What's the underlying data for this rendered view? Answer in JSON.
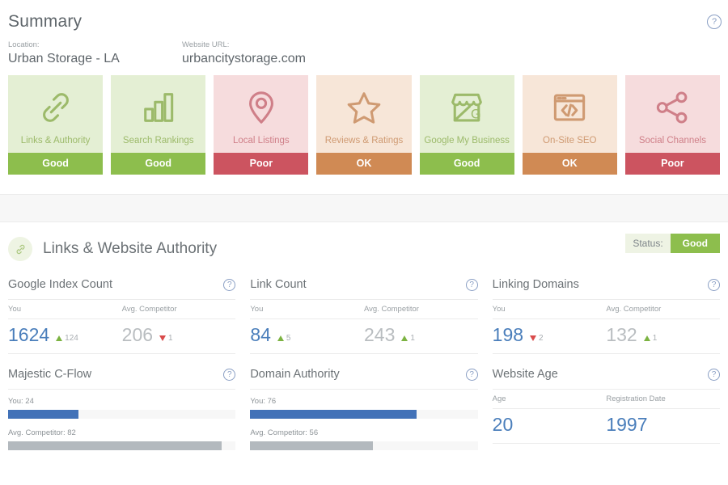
{
  "header": {
    "title": "Summary",
    "help_icon": "question-mark-icon",
    "location_label": "Location:",
    "location_value": "Urban Storage - LA",
    "url_label": "Website URL:",
    "url_value": "urbancitystorage.com"
  },
  "cards": [
    {
      "label": "Links & Authority",
      "status": "Good",
      "tone": "good",
      "icon": "chain-link-icon"
    },
    {
      "label": "Search Rankings",
      "status": "Good",
      "tone": "good",
      "icon": "bar-chart-icon"
    },
    {
      "label": "Local Listings",
      "status": "Poor",
      "tone": "poor",
      "icon": "map-pin-icon"
    },
    {
      "label": "Reviews & Ratings",
      "status": "OK",
      "tone": "ok",
      "icon": "star-icon"
    },
    {
      "label": "Google My Business",
      "status": "Good",
      "tone": "good",
      "icon": "storefront-icon"
    },
    {
      "label": "On-Site SEO",
      "status": "OK",
      "tone": "ok",
      "icon": "code-window-icon"
    },
    {
      "label": "Social Channels",
      "status": "Poor",
      "tone": "poor",
      "icon": "share-nodes-icon"
    }
  ],
  "section": {
    "icon": "chain-link-icon",
    "title": "Links & Website Authority",
    "status_label": "Status:",
    "status_value": "Good"
  },
  "metrics": {
    "google_index_count": {
      "title": "Google Index Count",
      "you_label": "You",
      "you_value": "1624",
      "you_delta": "124",
      "you_dir": "up",
      "comp_label": "Avg. Competitor",
      "comp_value": "206",
      "comp_delta": "1",
      "comp_dir": "down"
    },
    "link_count": {
      "title": "Link Count",
      "you_label": "You",
      "you_value": "84",
      "you_delta": "5",
      "you_dir": "up",
      "comp_label": "Avg. Competitor",
      "comp_value": "243",
      "comp_delta": "1",
      "comp_dir": "up"
    },
    "linking_domains": {
      "title": "Linking Domains",
      "you_label": "You",
      "you_value": "198",
      "you_delta": "2",
      "you_dir": "down",
      "comp_label": "Avg. Competitor",
      "comp_value": "132",
      "comp_delta": "1",
      "comp_dir": "up"
    },
    "majestic_cflow": {
      "title": "Majestic C-Flow",
      "you_label": "You: 24",
      "you_pct": 31,
      "comp_label": "Avg. Competitor: 82",
      "comp_pct": 94
    },
    "domain_authority": {
      "title": "Domain Authority",
      "you_label": "You: 76",
      "you_pct": 73,
      "comp_label": "Avg. Competitor: 56",
      "comp_pct": 54
    },
    "website_age": {
      "title": "Website Age",
      "age_label": "Age",
      "age_value": "20",
      "reg_label": "Registration Date",
      "reg_value": "1997"
    }
  },
  "icons": {
    "help": "?"
  }
}
